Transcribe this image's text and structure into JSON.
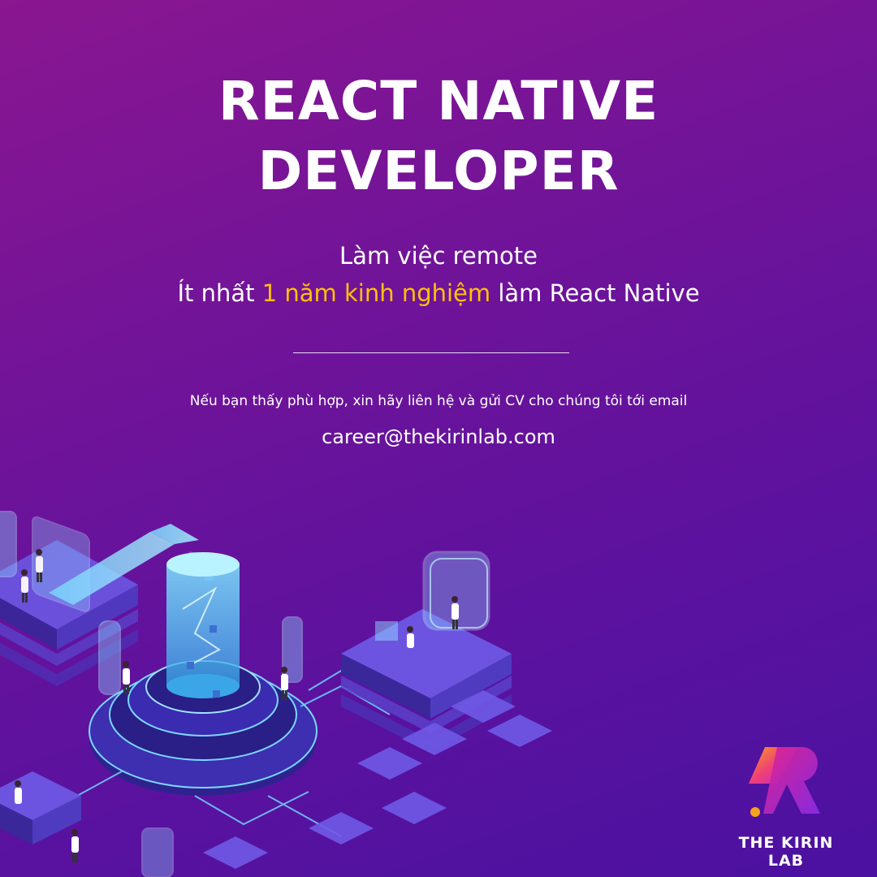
{
  "headline": {
    "line1": "REACT NATIVE",
    "line2": "DEVELOPER"
  },
  "details": {
    "line1": "Làm việc remote",
    "line2_before": "Ít nhất ",
    "line2_highlight": "1 năm kinh nghiệm",
    "line2_after": " làm React Native"
  },
  "contact": {
    "text": "Nếu bạn thấy phù hợp, xin hãy liên hệ và gửi CV cho chúng tôi tới email",
    "email": "career@thekirinlab.com"
  },
  "brand": {
    "name": "THE KIRIN LAB"
  },
  "colors": {
    "background": "#6d139a",
    "highlight": "#ffc107",
    "text": "#ffffff",
    "logo_gradient": [
      "#f7a21b",
      "#e0228f",
      "#8a2be2"
    ]
  },
  "icons": [
    "isometric-lab-illustration",
    "kirin-lab-logo"
  ]
}
